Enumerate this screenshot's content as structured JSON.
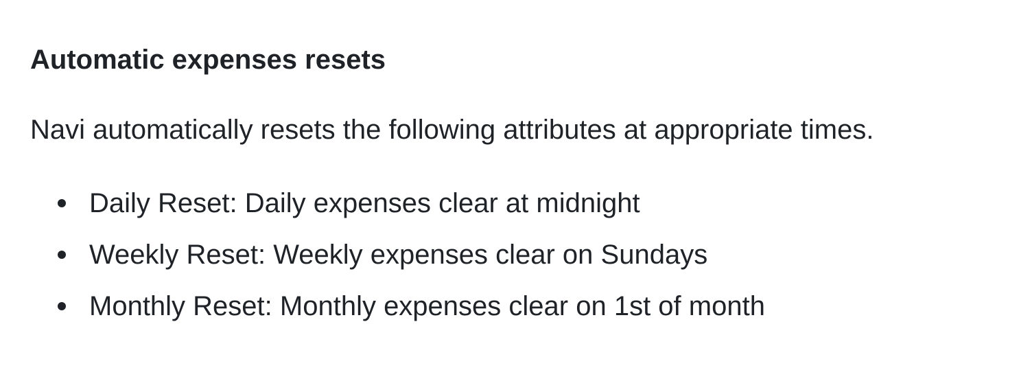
{
  "section": {
    "heading": "Automatic expenses resets",
    "intro": "Navi automatically resets the following attributes at appropriate times.",
    "items": [
      {
        "text": "Daily Reset: Daily expenses clear at midnight"
      },
      {
        "text": "Weekly Reset: Weekly expenses clear on Sundays"
      },
      {
        "text": "Monthly Reset: Monthly expenses clear on 1st of month"
      }
    ]
  }
}
